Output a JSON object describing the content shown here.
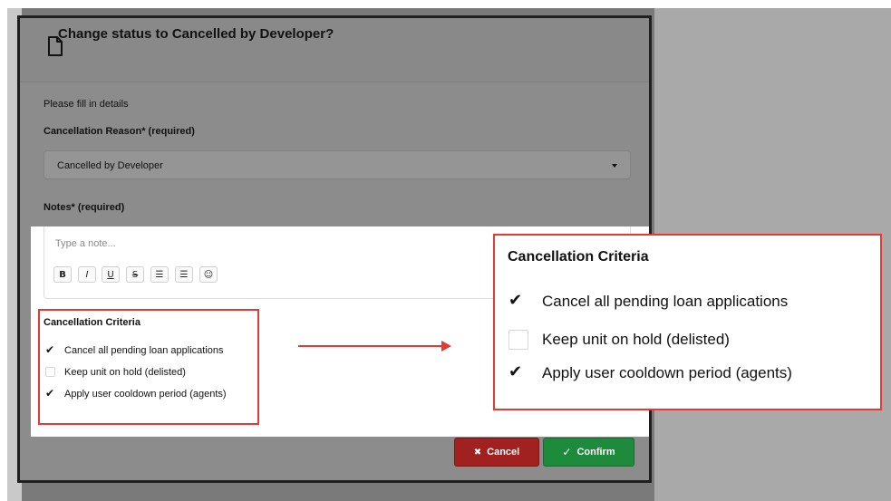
{
  "dialog": {
    "title": "Change status to Cancelled by Developer?",
    "instruction": "Please fill in details",
    "reason_label": "Cancellation Reason* (required)",
    "reason_value": "Cancelled by Developer",
    "notes_label": "Notes* (required)",
    "notes_placeholder": "Type a note...",
    "toolbar": {
      "bold": "B",
      "italic": "I",
      "underline": "U",
      "strike": "S",
      "bulleted_list": "☰",
      "numbered_list": "☰",
      "emoji": "☺"
    },
    "criteria": {
      "title": "Cancellation Criteria",
      "items": [
        {
          "label": "Cancel all pending loan applications",
          "checked": true
        },
        {
          "label": "Keep unit on hold (delisted)",
          "checked": false
        },
        {
          "label": "Apply user cooldown period (agents)",
          "checked": true
        }
      ]
    },
    "buttons": {
      "cancel": "Cancel",
      "cancel_icon": "✖",
      "confirm": "Confirm",
      "confirm_icon": "✓"
    }
  },
  "colors": {
    "highlight_red": "#e53935",
    "cancel_red": "#a12020",
    "confirm_green": "#1e8a3c"
  }
}
